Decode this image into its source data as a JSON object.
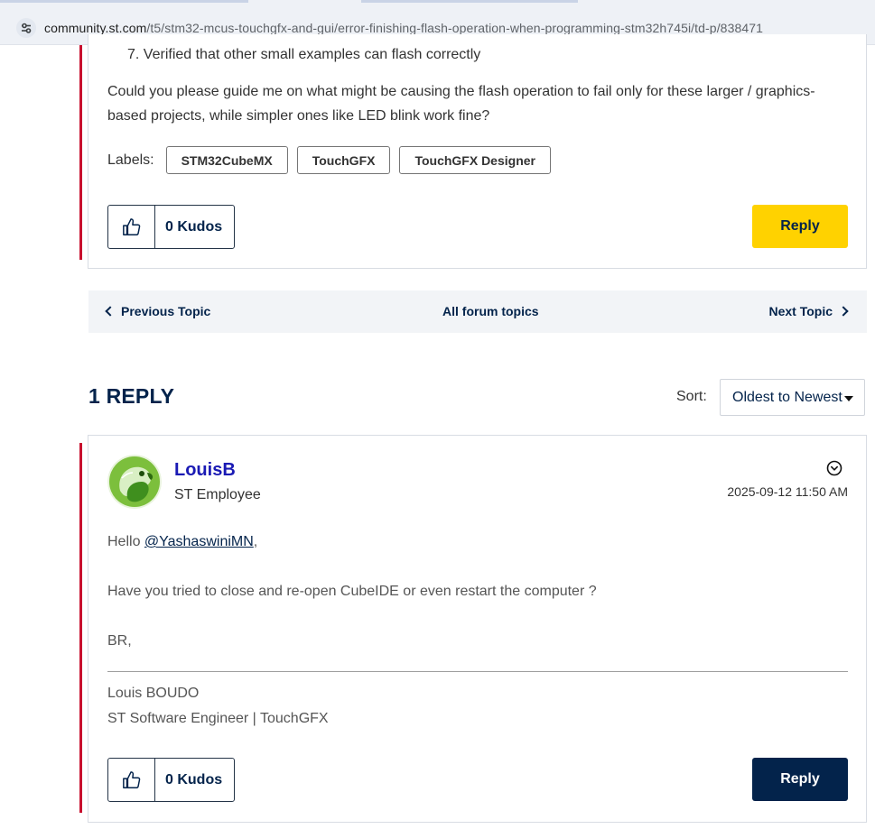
{
  "browser": {
    "url_domain": "community.st.com",
    "url_path": "/t5/stm32-mcus-touchgfx-and-gui/error-finishing-flash-operation-when-programming-stm32h745i/td-p/838471",
    "site_icon": "tune-icon"
  },
  "post": {
    "list_item_number": "7.",
    "list_item_text": "Verified that other small examples can flash correctly",
    "paragraph": "Could you please guide me on what might be causing the flash operation to fail only for these larger / graphics-based projects, while simpler ones like LED blink work fine?",
    "labels_title": "Labels:",
    "labels": [
      "STM32CubeMX",
      "TouchGFX",
      "TouchGFX Designer"
    ],
    "kudos": "0 Kudos",
    "reply_label": "Reply"
  },
  "topic_nav": {
    "previous": "Previous Topic",
    "all": "All forum topics",
    "next": "Next Topic"
  },
  "replies": {
    "title": "1 REPLY",
    "sort_label": "Sort:",
    "sort_value": "Oldest to Newest"
  },
  "reply_post": {
    "author": "LouisB",
    "rank": "ST Employee",
    "date": "2025-09-12 11:50 AM",
    "greeting_prefix": "Hello ",
    "mention": "@YashaswiniMN",
    "greeting_suffix": ",",
    "question": "Have you tried to close and re-open CubeIDE or even restart the computer ?",
    "closing": "BR,",
    "sig_name": "Louis BOUDO",
    "sig_title": "ST Software Engineer | TouchGFX",
    "kudos": "0 Kudos",
    "reply_label": "Reply"
  },
  "colors": {
    "brand_navy": "#03234b",
    "reply_yellow": "#ffd200",
    "accent_red": "#c8102e",
    "author_blue": "#1a1ab4"
  }
}
